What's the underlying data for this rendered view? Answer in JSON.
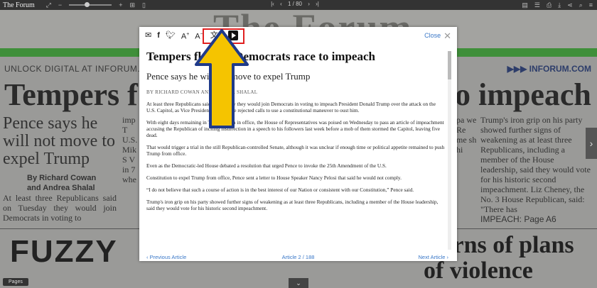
{
  "topbar": {
    "title": "The Forum",
    "page_indicator": "1 / 80"
  },
  "newspaper": {
    "masthead": "The Forum",
    "unlock": "UNLOCK DIGITAL AT INFORUM.COM",
    "inforum": "▶▶▶ INFORUM.COM",
    "headline_left": "Tempers f",
    "headline_right": "o impeach",
    "deck": "Pence says he will not move to expel Trump",
    "byline_1": "By Richard Cowan",
    "byline_2": "and Andrea Shalal",
    "body_left": "At least three Republicans said on Tuesday they would join Democrats in voting to",
    "col_mid": "imp T U.S. Mik S V in 7 whe",
    "col_r2": "pa we Re me sh hi",
    "col_right": "Trump's iron grip on his party showed further signs of weakening as at least three Republicans, including a member of the House leadership, said they would vote for his historic second impeachment. Liz Cheney, the No. 3 House Republican, said: \"There has",
    "impeach_jump": "IMPEACH: Page A6",
    "fuzzy": "FUZZY",
    "warns": "warns of plans of violence",
    "pages_button": "Pages"
  },
  "modal": {
    "close_label": "Close",
    "title": "Tempers flare as Democrats race to impeach",
    "subtitle": "Pence says he will not move to expel Trump",
    "byline": "BY RICHARD COWAN AND ANDREA SHALAL",
    "paragraphs": [
      "At least three Republicans said on Tuesday they would join Democrats in voting to impeach President Donald Trump over the attack on the U.S. Capitol, as Vice President Mike Pence rejected calls to use a constitutional maneuver to oust him.",
      "With eight days remaining in Trump's term in office, the House of Representatives was poised on Wednesday to pass an article of impeachment accusing the Republican of inciting insurrection in a speech to his followers last week before a mob of them stormed the Capitol, leaving five dead.",
      "That would trigger a trial in the still Republican-controlled Senate, although it was unclear if enough time or political appetite remained to push Trump from office.",
      "Even as the Democratic-led House debated a resolution that urged Pence to invoke the 25th Amendment of the U.S.",
      "Constitution to expel Trump from office, Pence sent a letter to House Speaker Nancy Pelosi that said he would not comply.",
      "“I do not believe that such a course of action is in the best interest of our Nation or consistent with our Constitution,” Pence said.",
      "Trump's iron grip on his party showed further signs of weakening as at least three Republicans, including a member of the House leadership, said they would vote for his historic second impeachment."
    ],
    "footer": {
      "prev": "‹ Previous Article",
      "counter": "Article 2 / 188",
      "next": "Next Article ›"
    }
  },
  "colors": {
    "highlight": "#e02020",
    "arrow_fill": "#f5c400",
    "arrow_stroke": "#1f3a8a",
    "link": "#3a78c8"
  }
}
